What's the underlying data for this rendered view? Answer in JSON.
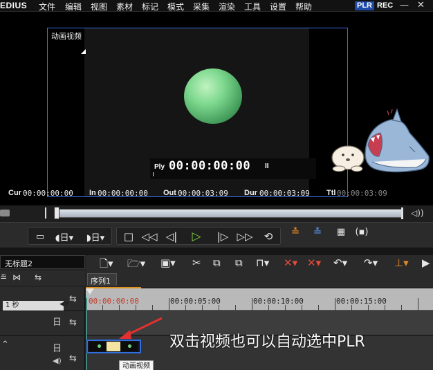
{
  "app": {
    "name": "EDIUS"
  },
  "menu": {
    "items": [
      "文件",
      "编辑",
      "视图",
      "素材",
      "标记",
      "模式",
      "采集",
      "渲染",
      "工具",
      "设置",
      "帮助"
    ],
    "plr_badge": "PLR",
    "rec_label": "REC",
    "minimize": "—",
    "close": "✕"
  },
  "player": {
    "title": "动画视频",
    "timecode_label": "Ply",
    "timecode": "00:00:00:00",
    "pause_mark": "II",
    "ball_color": "#7dd88e"
  },
  "timecodes": {
    "cur_label": "Cur",
    "cur": "00:00:00:00",
    "in_label": "In",
    "in": "00:00:00:00",
    "out_label": "Out",
    "out": "00:00:03:09",
    "dur_label": "Dur",
    "dur": "00:00:03:09",
    "ttl_label": "Ttl",
    "ttl": "00:00:03:09"
  },
  "transport": {
    "buttons": [
      "marker-icon",
      "in-out-icon",
      "in-point-icon",
      "out-point-icon",
      "stop-icon",
      "rewind-icon",
      "step-back-icon",
      "play-icon",
      "step-forward-icon",
      "fast-forward-icon",
      "loop-icon",
      "insert-icon",
      "overwrite-icon",
      "render-icon",
      "sync-icon"
    ],
    "play_color": "#7fcf3a"
  },
  "project": {
    "name": "无标题2"
  },
  "sequence": {
    "tab": "序列1"
  },
  "scale": {
    "value": "1 秒"
  },
  "ruler": {
    "labels": [
      "00:00:00:00",
      "00:00:05:00",
      "00:00:10:00",
      "00:00:15:00"
    ]
  },
  "tracks": {
    "v1": {
      "mark": "日"
    },
    "va": {
      "mark": "日"
    }
  },
  "clip": {
    "tooltip": "动画视频",
    "border_color": "#2f6fe0"
  },
  "annotation": {
    "text": "双击视频也可以自动选中PLR"
  },
  "colors": {
    "accent": "#3f6fe0",
    "playhead": "#4dd0c8",
    "orange": "#e0901e"
  }
}
